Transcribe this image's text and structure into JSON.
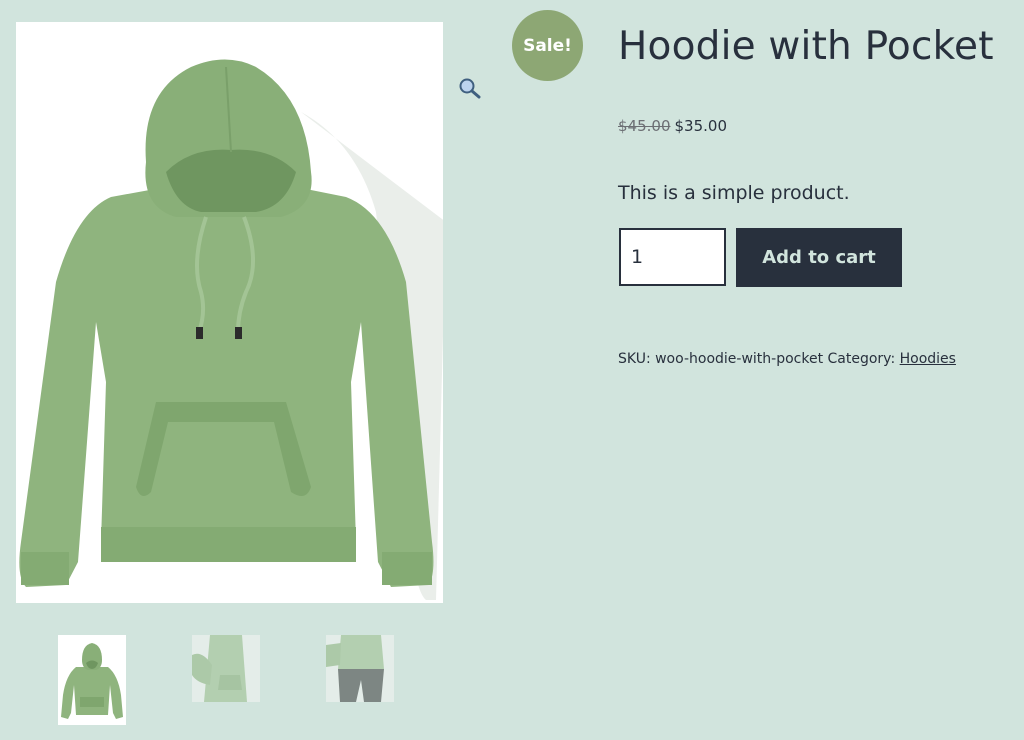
{
  "product": {
    "title": "Hoodie with Pocket",
    "sale_badge": "Sale!",
    "regular_price": "$45.00",
    "sale_price": "$35.00",
    "short_description": "This is a simple product.",
    "quantity": "1",
    "add_to_cart_label": "Add to cart",
    "sku_label": "SKU:",
    "sku": "woo-hoodie-with-pocket",
    "category_label": "Category:",
    "category": "Hoodies"
  },
  "gallery": {
    "zoom_icon": "search-icon",
    "hoodie_color": "#8fb47e",
    "thumbnails": [
      "hoodie-front",
      "hoodie-worn-side",
      "hoodie-worn-pants"
    ]
  },
  "colors": {
    "background": "#d1e4dd",
    "text": "#28303d",
    "sale_badge": "#8da774",
    "button_bg": "#28303d"
  }
}
